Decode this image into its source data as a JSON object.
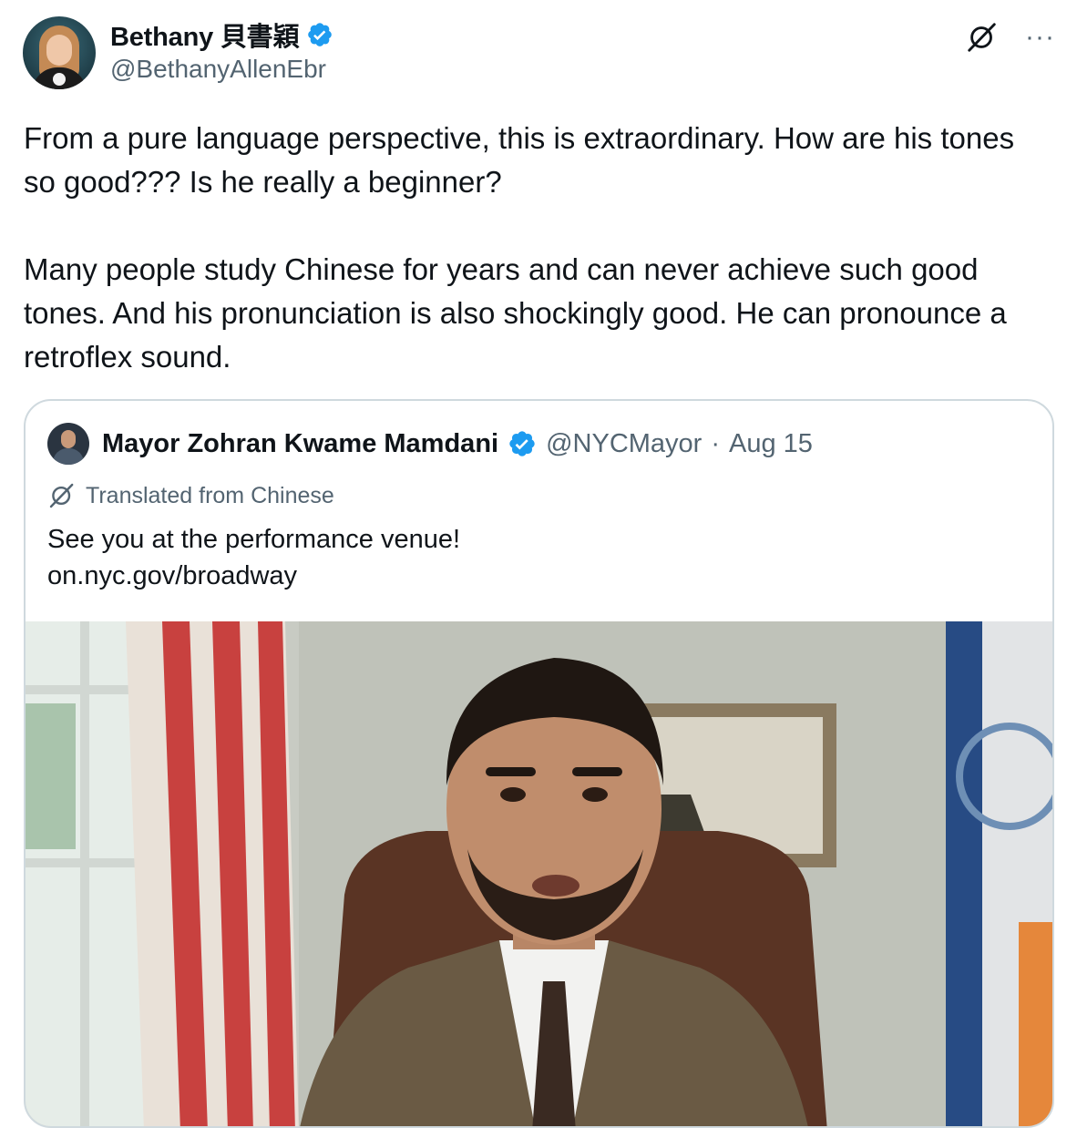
{
  "author": {
    "display_name": "Bethany 貝書穎",
    "handle": "@BethanyAllenEbr",
    "verified": true
  },
  "icons": {
    "grok": "grok-icon",
    "more": "more-horizontal-icon",
    "verified": "verified-badge-icon",
    "translate": "translate-icon"
  },
  "more_glyph": "···",
  "tweet_text": "From a pure language perspective, this is extraordinary. How are his tones so good??? Is he really a beginner?\n\nMany people study Chinese for years and can never achieve such good tones. And his pronunciation is also shockingly good. He can pronounce a retroflex sound.",
  "quoted": {
    "display_name": "Mayor Zohran Kwame Mamdani",
    "handle": "@NYCMayor",
    "separator": "·",
    "date": "Aug 15",
    "translated_label": "Translated from Chinese",
    "text": "See you at the performance venue!",
    "link": "on.nyc.gov/broadway"
  },
  "colors": {
    "text_primary": "#0f1419",
    "text_secondary": "#536471",
    "border": "#cfd9de",
    "verified_blue": "#1d9bf0"
  }
}
